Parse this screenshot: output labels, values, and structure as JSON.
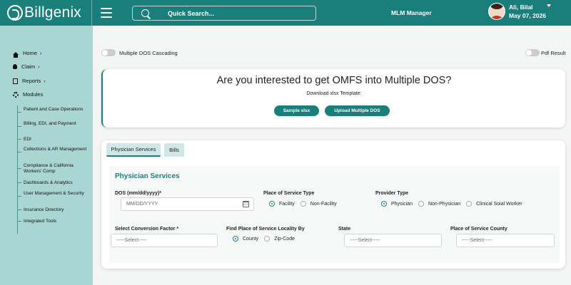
{
  "header": {
    "logo_text": "Billgenix",
    "search_placeholder": "Quick Search...",
    "company": "MLM Manager",
    "user_name": "Ali, Bilal",
    "user_date": "May 07, 2026",
    "accent_color": "#1a7f7a"
  },
  "sidebar": {
    "items": [
      {
        "label": "Home",
        "icon": "home-icon"
      },
      {
        "label": "Claim",
        "icon": "claim-icon"
      },
      {
        "label": "Reports",
        "icon": "report-icon"
      },
      {
        "label": "Modules",
        "icon": "gear-icon"
      }
    ],
    "modules": [
      "Patient and Case Operations",
      "Billing, EDI, and Payment",
      "EDI",
      "Collections & AR Management",
      "Compliance & California Workers' Comp",
      "Dashboards & Analytics",
      "User Management & Security",
      "Insurance Directory",
      "Integrated Tools"
    ]
  },
  "toggles": {
    "multiple_dos": "Multiple DOS Cascading",
    "pdf_result": "Pdf Result"
  },
  "omfs": {
    "title": "Are you interested to get OMFS into Multiple DOS?",
    "download_label": "Download xlsx Template:",
    "sample_button": "Sample xlsx",
    "upload_button": "Upload Multiple DOS"
  },
  "tabs": [
    "Physician Services",
    "Bills"
  ],
  "form": {
    "section_title": "Physician Services",
    "dos_label": "DOS (mm/dd/yyyy)*",
    "dos_placeholder": "MM/DD/YYYY",
    "pos_type_label": "Place of Service Type",
    "pos_type_options": [
      "Facility",
      "Non-Facility"
    ],
    "provider_type_label": "Provider Type",
    "provider_type_options": [
      "Physician",
      "Non-Physician",
      "Clinical Soial Worker"
    ],
    "conversion_label": "Select Conversion Factor *",
    "locality_label": "Find Place of Service Locality By",
    "locality_options": [
      "County",
      "Zip-Code"
    ],
    "state_label": "State",
    "county_label": "Place of Service County",
    "select_placeholder": "-----Select-----"
  }
}
